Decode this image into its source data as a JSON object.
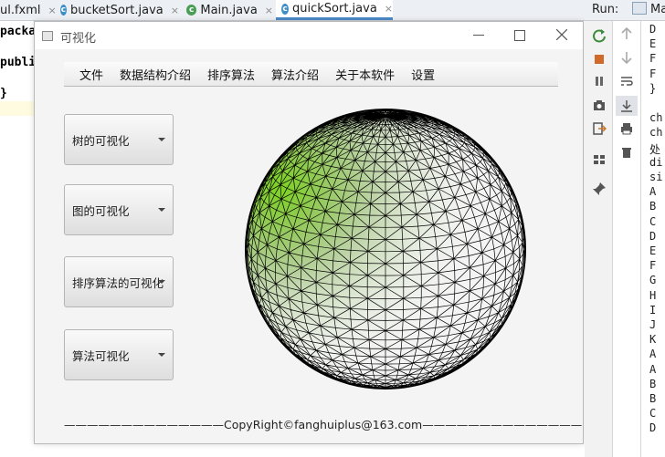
{
  "ide": {
    "tabs": [
      {
        "label": "ul.fxml",
        "close": "×"
      },
      {
        "label": "bucketSort.java",
        "icon": "c",
        "close": "×"
      },
      {
        "label": "Main.java",
        "icon": "c",
        "close": "×"
      },
      {
        "label": "quickSort.java",
        "icon": "c",
        "close": "×"
      }
    ],
    "code": [
      "packa",
      "publi",
      "}"
    ],
    "run_label": "Run:",
    "run_tab": "Ma"
  },
  "app": {
    "title": "可视化",
    "menu": [
      "文件",
      "数据结构介绍",
      "排序算法",
      "算法介绍",
      "关于本软件",
      "设置"
    ],
    "combos": [
      "树的可视化",
      "图的可视化",
      "排序算法的可视化",
      "算法可视化"
    ],
    "footer": "——————————————CopyRight©fanghuiplus@163.com——————————————"
  },
  "console": {
    "lines": [
      "D",
      "E",
      "F",
      "F",
      "}",
      "",
      "ch",
      "ch",
      "处",
      "di",
      "si",
      "A",
      "B",
      "C",
      "D",
      "E",
      "F",
      "G",
      "H",
      "I",
      "J",
      "K",
      "A",
      "A",
      "B",
      "B",
      "C",
      "D"
    ]
  },
  "colors": {
    "accent": "#4a88c7",
    "sphere_highlight": "#7ed321"
  }
}
